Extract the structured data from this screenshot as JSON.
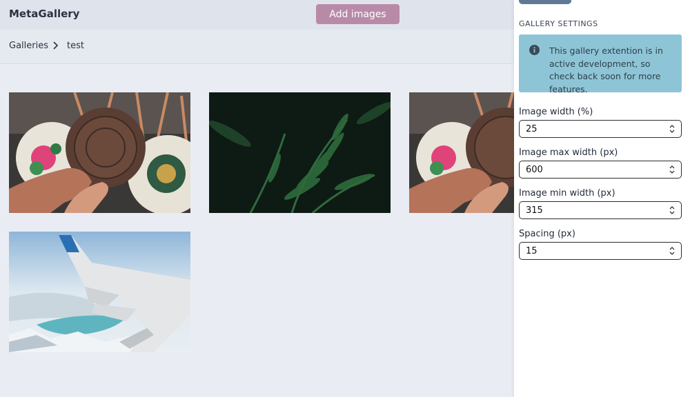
{
  "app": {
    "title": "MetaGallery"
  },
  "toolbar": {
    "add_images_label": "Add images"
  },
  "breadcrumb": {
    "root": "Galleries",
    "current": "test"
  },
  "gallery": {
    "images": [
      {
        "subject": "woven-bags-photo"
      },
      {
        "subject": "fern-leaves-photo"
      },
      {
        "subject": "woven-bags-photo"
      },
      {
        "subject": "airplane-wing-photo"
      }
    ]
  },
  "settings": {
    "heading": "GALLERY SETTINGS",
    "notice": "This gallery extention is in active development, so check back soon for more features.",
    "notice_icon": "info-icon",
    "fields": [
      {
        "label": "Image width (%)",
        "value": "25"
      },
      {
        "label": "Image max width (px)",
        "value": "600"
      },
      {
        "label": "Image min width (px)",
        "value": "315"
      },
      {
        "label": "Spacing (px)",
        "value": "15"
      }
    ]
  },
  "colors": {
    "accent_button": "#b98aa8",
    "notice_bg": "#8ec5d6",
    "topbar_bg": "#dfe3ec",
    "page_bg": "#e9edf3"
  }
}
